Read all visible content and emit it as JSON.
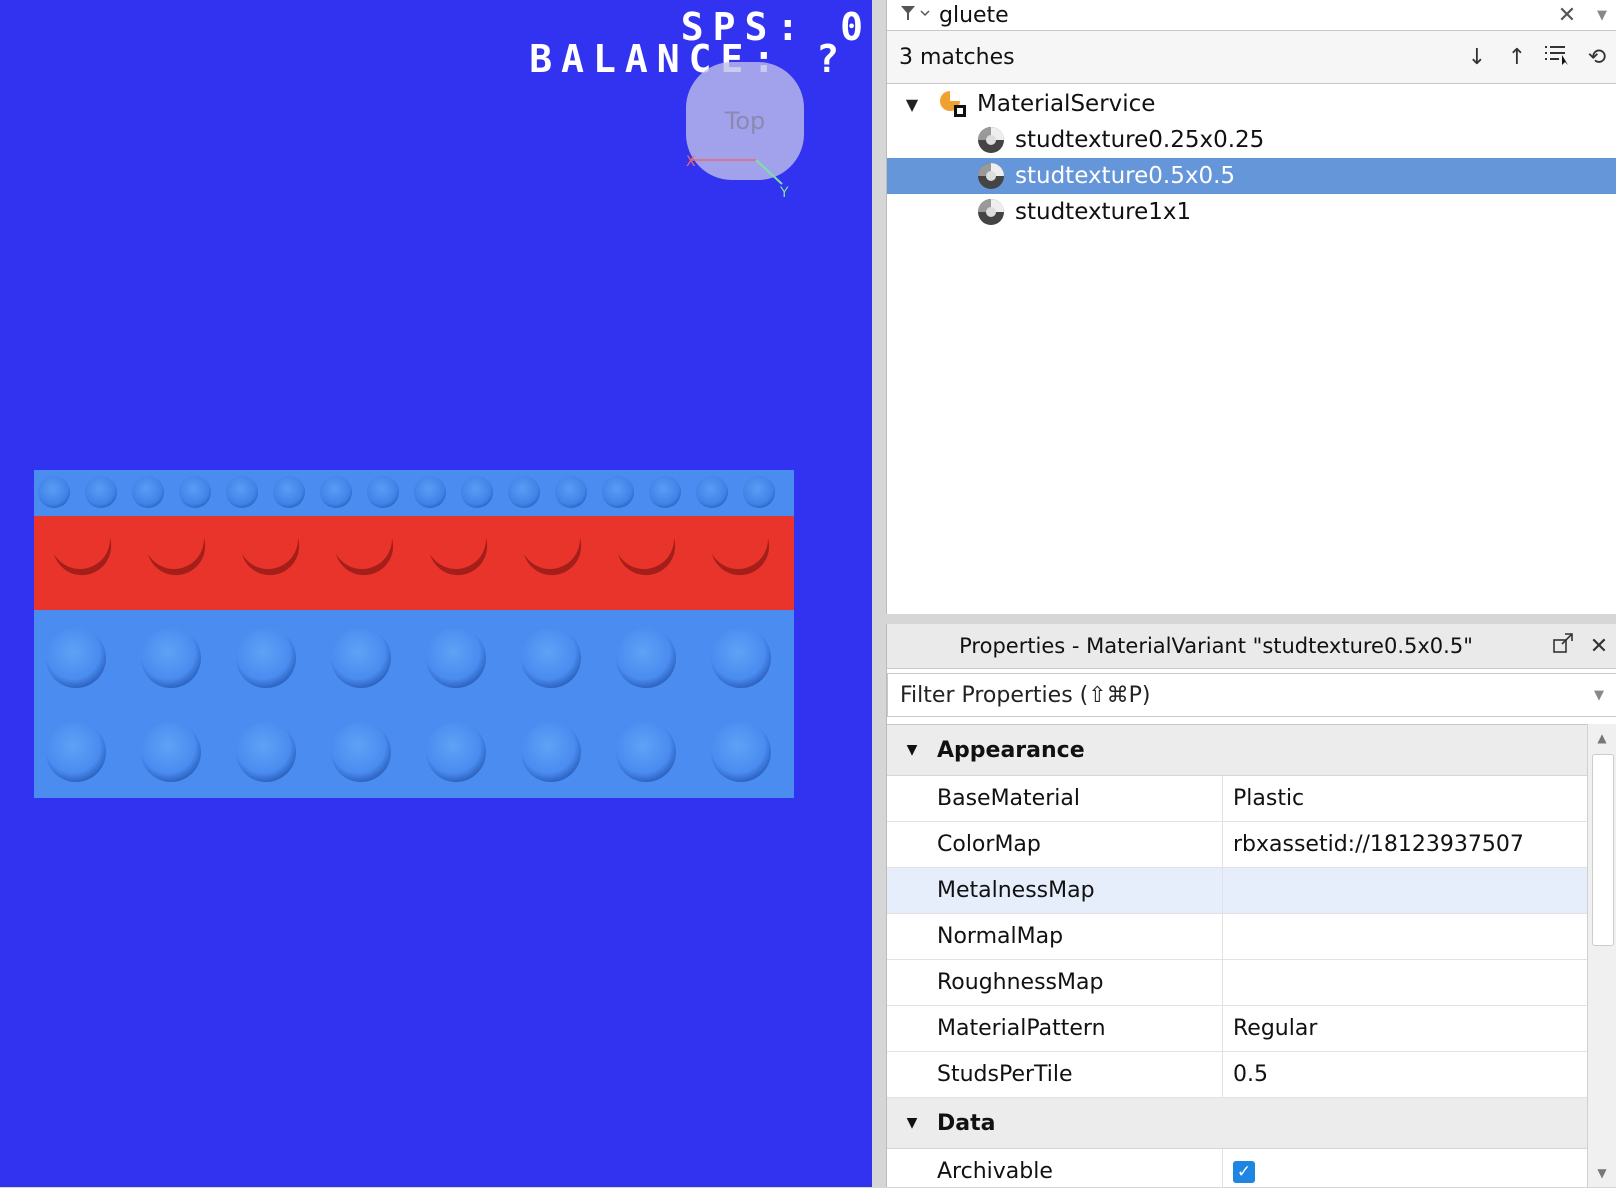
{
  "viewport": {
    "sps_text": "SPS: 0",
    "balance_text": "BALANCE: ?",
    "view_cube_label": "Top",
    "axis_x_label": "X",
    "axis_y_label": "Y"
  },
  "explorer": {
    "search_value": "gluete",
    "matches_text": "3 matches",
    "tree": {
      "root_label": "MaterialService",
      "children": [
        {
          "label": "studtexture0.25x0.25"
        },
        {
          "label": "studtexture0.5x0.5"
        },
        {
          "label": "studtexture1x1"
        }
      ]
    }
  },
  "properties": {
    "title": "Properties - MaterialVariant \"studtexture0.5x0.5\"",
    "filter_placeholder": "Filter Properties (⇧⌘P)",
    "categories": [
      {
        "name": "Appearance",
        "rows": [
          {
            "name": "BaseMaterial",
            "value": "Plastic"
          },
          {
            "name": "ColorMap",
            "value": "rbxassetid://18123937507"
          },
          {
            "name": "MetalnessMap",
            "value": ""
          },
          {
            "name": "NormalMap",
            "value": ""
          },
          {
            "name": "RoughnessMap",
            "value": ""
          },
          {
            "name": "MaterialPattern",
            "value": "Regular"
          },
          {
            "name": "StudsPerTile",
            "value": "0.5"
          }
        ]
      },
      {
        "name": "Data",
        "rows": [
          {
            "name": "Archivable",
            "value": "checked"
          }
        ]
      }
    ]
  },
  "colors": {
    "viewport_bg": "#3233f1",
    "brick_blue": "#4a8cf0",
    "brick_red": "#e8342a",
    "selection": "#6596da",
    "checkbox": "#1e86e0"
  }
}
